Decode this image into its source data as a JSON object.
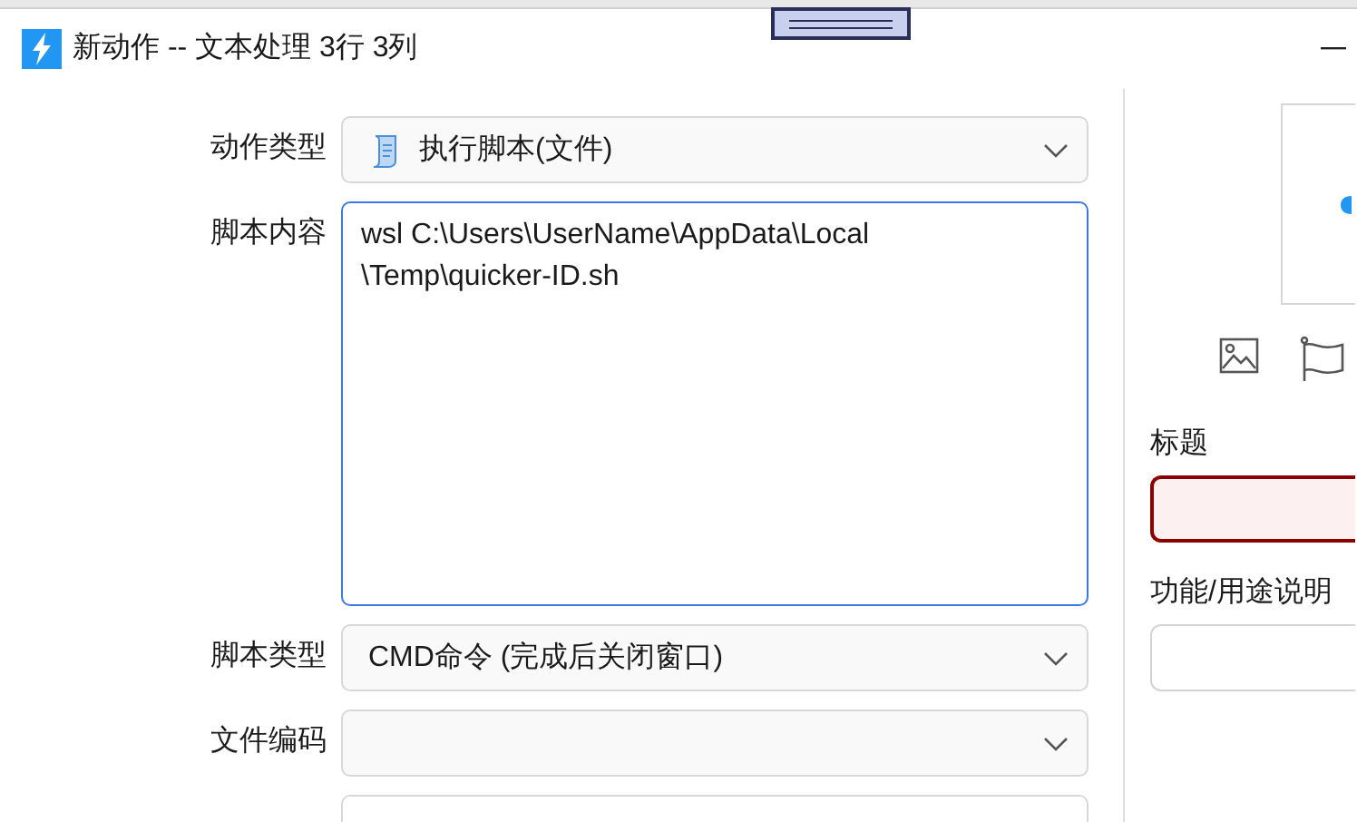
{
  "window": {
    "title": "新动作 -- 文本处理 3行 3列"
  },
  "form": {
    "fields": [
      {
        "label": "动作类型",
        "kind": "iconselect",
        "value": "执行脚本(文件)"
      },
      {
        "label": "脚本内容",
        "kind": "textarea",
        "focused": true,
        "lines": [
          "wsl C:\\Users\\UserName\\AppData\\Local",
          "\\Temp\\quicker-ID.sh"
        ]
      },
      {
        "label": "脚本类型",
        "kind": "select",
        "value": "CMD命令 (完成后关闭窗口)"
      },
      {
        "label": "文件编码",
        "kind": "select"
      },
      {
        "kind": "text"
      }
    ]
  },
  "side": {
    "fields": [
      {
        "label": "标题",
        "invalid": true
      },
      {
        "label": "功能/用途说明",
        "invalid": false
      }
    ]
  }
}
